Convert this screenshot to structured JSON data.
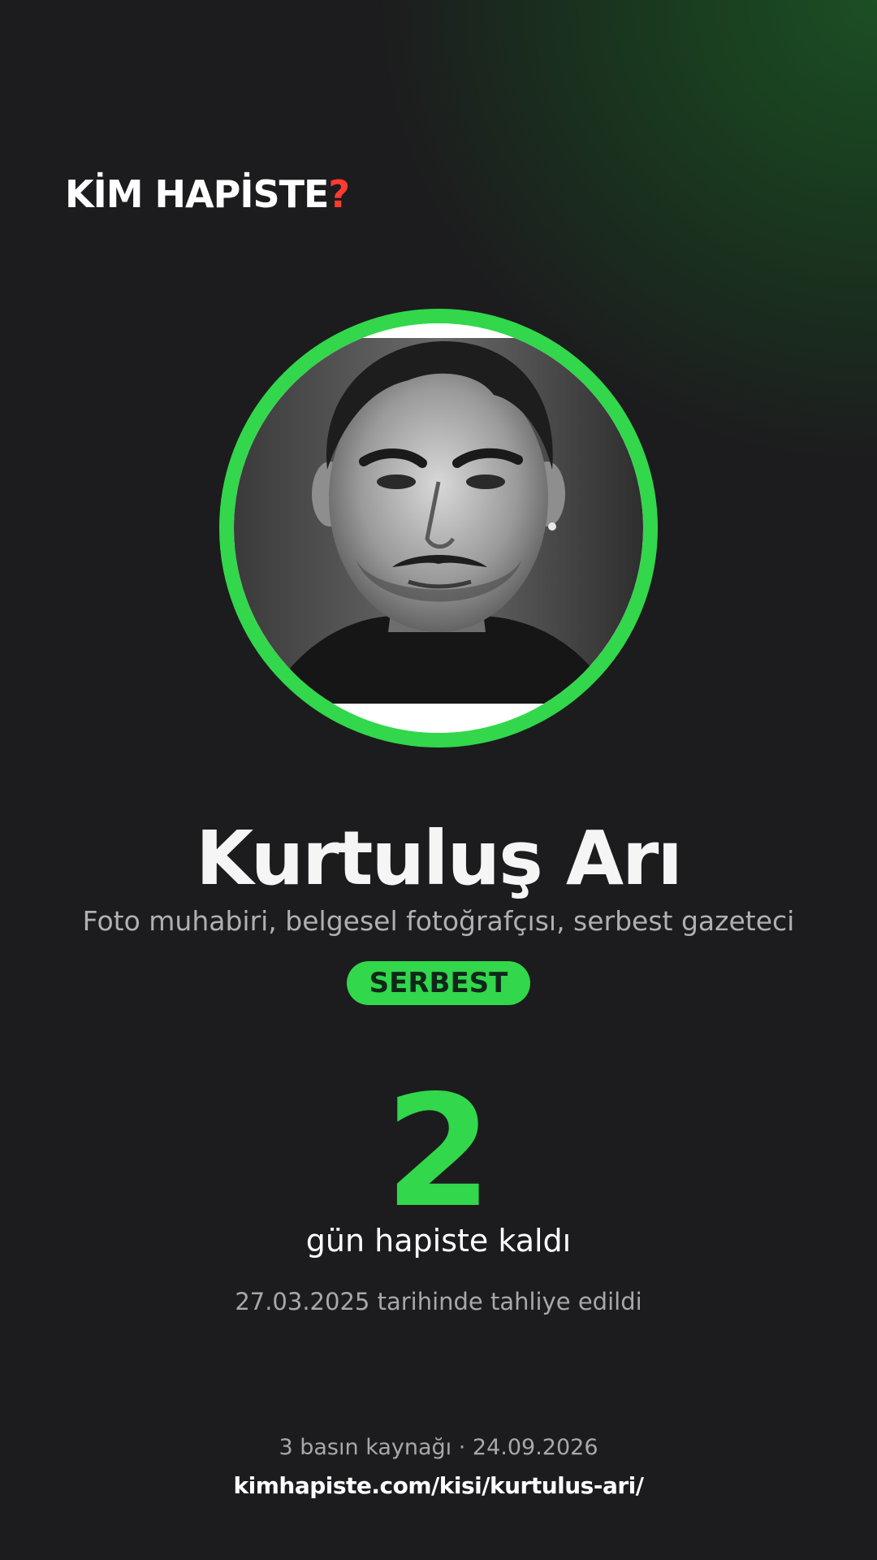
{
  "brand": {
    "logo_text": "KİM HAPİSTE",
    "logo_mark": "?",
    "accent_color": "#32d74b",
    "mark_color": "#ff3b30",
    "background_color": "#1c1c1e"
  },
  "person": {
    "name": "Kurtuluş Arı",
    "role": "Foto muhabiri, belgesel fotoğrafçısı, serbest gazeteci",
    "status": "SERBEST",
    "photo_icon": "portrait-photo"
  },
  "stats": {
    "days": "2",
    "days_label": "gün hapiste kaldı",
    "release_text": "27.03.2025 tarihinde tahliye edildi"
  },
  "footer": {
    "sources_text": "3 basın kaynağı · 24.09.2026",
    "url": "kimhapiste.com/kisi/kurtulus-ari/"
  }
}
